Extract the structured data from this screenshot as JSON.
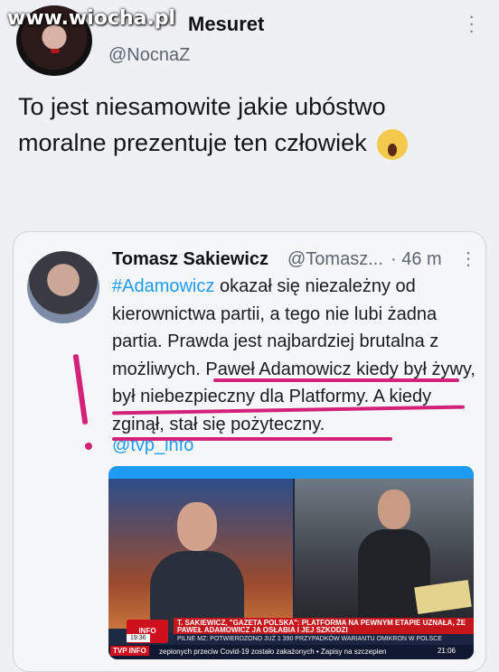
{
  "watermark": "www.wiocha.pl",
  "author": {
    "display_name": "Mesuret",
    "handle": "@NocnaZ",
    "avatar_icon": "avatar-photo"
  },
  "tweet": {
    "text": "To jest niesamowite jakie ubóstwo moralne prezentuje ten człowiek",
    "emoji_icon": "face-screaming-in-fear-icon"
  },
  "quoted": {
    "display_name": "Tomasz Sakiewicz",
    "handle": "@Tomasz...",
    "time": "· 46 m",
    "hashtag": "#Adamowicz",
    "text": " okazał się niezależny od kierownictwa partii, a tego nie lubi żadna partia. Prawda jest najbardziej brutalna z możliwych. Paweł Adamowicz kiedy był żywy, był niebezpieczny dla Platformy. A kiedy zginął, stał się pożyteczny.",
    "mention": "@tvp_info"
  },
  "media": {
    "ticker_headline": "T. SAKIEWICZ, \"GAZETA POLSKA\": PLATFORMA NA PEWNYM ETAPIE UZNAŁA, ŻE PAWEŁ ADAMOWICZ JA OSŁABIA I JEJ SZKODZI",
    "ticker_flash": "PILNE   MZ: POTWIERDZONO JUŻ 1 390 PRZYPADKÓW WARIANTU OMIKRON W POLSCE",
    "ticker_bottom": "zepionych przeciw Covid-19 zostało zakażonych • Zapisy na szczepien",
    "channel": "TVP INFO",
    "clock": "21:06",
    "side_time": "19:36"
  },
  "colors": {
    "accent": "#1d9bf0",
    "highlight_ink": "#d4227a"
  }
}
